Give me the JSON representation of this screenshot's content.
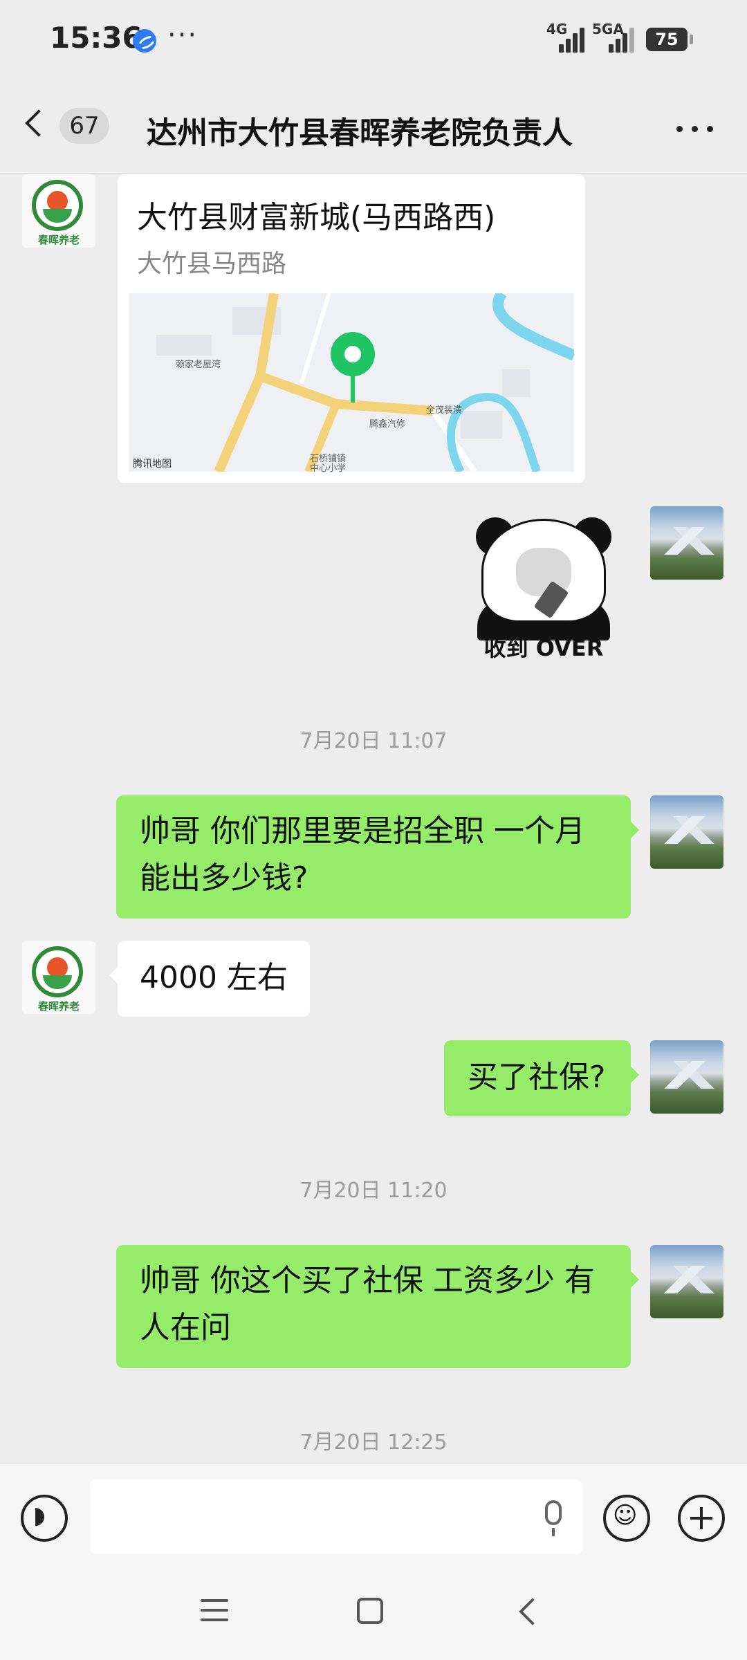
{
  "status_bar": {
    "time": "15:36",
    "more": "···",
    "net1": "4G",
    "net2": "5GA",
    "battery": "75"
  },
  "header": {
    "back_count": "67",
    "title": "达州市大竹县春晖养老院负责人"
  },
  "contact_logo_text": "春晖养老",
  "location": {
    "title": "大竹县财富新城(马西路西)",
    "address": "大竹县马西路",
    "map_labels": [
      "赖家老屋湾",
      "全茂装潢",
      "腾鑫汽修",
      "石桥铺镇",
      "中心小学"
    ],
    "map_brand": "腾讯地图"
  },
  "sticker_text": "收到 OVER",
  "messages": [
    {
      "timestamp": "7月20日 11:07"
    },
    {
      "from": "self",
      "text_line1": "帅哥  你们那里要是招全职  一个月",
      "text_line2": "能出多少钱?"
    },
    {
      "from": "other",
      "text": "4000 左右"
    },
    {
      "from": "self",
      "text": "买了社保?"
    },
    {
      "timestamp": "7月20日 11:20"
    },
    {
      "from": "self",
      "text_line1": "帅哥  你这个买了社保 工资多少 有",
      "text_line2": "人在问"
    },
    {
      "timestamp": "7月20日 12:25"
    }
  ],
  "colors": {
    "background": "#ededed",
    "self_bubble": "#95ec69",
    "other_bubble": "#ffffff",
    "map_pin": "#1fc463"
  }
}
